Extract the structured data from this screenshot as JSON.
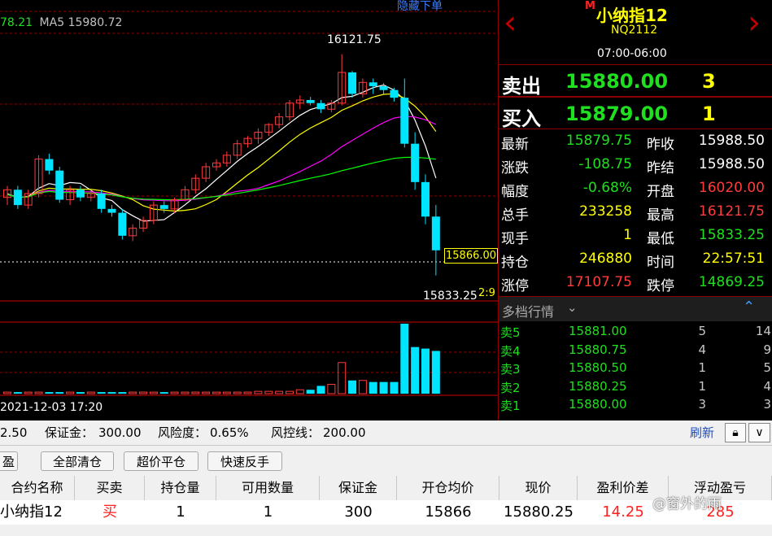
{
  "chart": {
    "hide_order_link": "隐藏下单",
    "ma_partial": "78.21",
    "ma5_label": "MA5",
    "ma5_value": "15980.72",
    "high_label": "16121.75",
    "low_label": "15833.25",
    "current_tag": "15866.00",
    "ratio_tag": "2:9",
    "date_label": "2021-12-03 17:20",
    "colors": {
      "up": "#ff3b3b",
      "down": "#00e5ff",
      "ma5": "#ffffff",
      "ma10": "#ffff00",
      "ma20": "#ff00ff",
      "ma60": "#00ff00",
      "grid": "#8a0000"
    }
  },
  "chart_data": {
    "type": "candlestick",
    "price_range": [
      15800,
      16150
    ],
    "candles": [
      {
        "o": 15935,
        "c": 15945,
        "h": 15950,
        "l": 15925
      },
      {
        "o": 15945,
        "c": 15925,
        "h": 15950,
        "l": 15920
      },
      {
        "o": 15925,
        "c": 15940,
        "h": 15945,
        "l": 15920
      },
      {
        "o": 15940,
        "c": 15985,
        "h": 15990,
        "l": 15935
      },
      {
        "o": 15985,
        "c": 15970,
        "h": 15992,
        "l": 15965
      },
      {
        "o": 15970,
        "c": 15932,
        "h": 15975,
        "l": 15928
      },
      {
        "o": 15932,
        "c": 15945,
        "h": 15950,
        "l": 15925
      },
      {
        "o": 15945,
        "c": 15935,
        "h": 15950,
        "l": 15930
      },
      {
        "o": 15935,
        "c": 15940,
        "h": 15945,
        "l": 15930
      },
      {
        "o": 15940,
        "c": 15920,
        "h": 15945,
        "l": 15915
      },
      {
        "o": 15920,
        "c": 15915,
        "h": 15925,
        "l": 15910
      },
      {
        "o": 15915,
        "c": 15885,
        "h": 15920,
        "l": 15880
      },
      {
        "o": 15885,
        "c": 15895,
        "h": 15900,
        "l": 15878
      },
      {
        "o": 15895,
        "c": 15905,
        "h": 15910,
        "l": 15890
      },
      {
        "o": 15905,
        "c": 15925,
        "h": 15930,
        "l": 15900
      },
      {
        "o": 15925,
        "c": 15920,
        "h": 15930,
        "l": 15915
      },
      {
        "o": 15920,
        "c": 15932,
        "h": 15935,
        "l": 15915
      },
      {
        "o": 15932,
        "c": 15945,
        "h": 15950,
        "l": 15930
      },
      {
        "o": 15945,
        "c": 15960,
        "h": 15965,
        "l": 15940
      },
      {
        "o": 15960,
        "c": 15975,
        "h": 15980,
        "l": 15955
      },
      {
        "o": 15975,
        "c": 15980,
        "h": 15985,
        "l": 15970
      },
      {
        "o": 15980,
        "c": 15990,
        "h": 15995,
        "l": 15975
      },
      {
        "o": 15990,
        "c": 16005,
        "h": 16010,
        "l": 15985
      },
      {
        "o": 16005,
        "c": 16012,
        "h": 16015,
        "l": 16000
      },
      {
        "o": 16012,
        "c": 16020,
        "h": 16025,
        "l": 16005
      },
      {
        "o": 16020,
        "c": 16030,
        "h": 16032,
        "l": 16015
      },
      {
        "o": 16030,
        "c": 16040,
        "h": 16045,
        "l": 16025
      },
      {
        "o": 16040,
        "c": 16058,
        "h": 16062,
        "l": 16035
      },
      {
        "o": 16058,
        "c": 16062,
        "h": 16068,
        "l": 16050
      },
      {
        "o": 16062,
        "c": 16058,
        "h": 16066,
        "l": 16055
      },
      {
        "o": 16058,
        "c": 16050,
        "h": 16062,
        "l": 16045
      },
      {
        "o": 16050,
        "c": 16058,
        "h": 16062,
        "l": 16046
      },
      {
        "o": 16058,
        "c": 16098,
        "h": 16121.75,
        "l": 16055
      },
      {
        "o": 16098,
        "c": 16070,
        "h": 16100,
        "l": 16065
      },
      {
        "o": 16070,
        "c": 16085,
        "h": 16090,
        "l": 16065
      },
      {
        "o": 16085,
        "c": 16080,
        "h": 16090,
        "l": 16070
      },
      {
        "o": 16080,
        "c": 16075,
        "h": 16084,
        "l": 16070
      },
      {
        "o": 16075,
        "c": 16065,
        "h": 16078,
        "l": 16060
      },
      {
        "o": 16065,
        "c": 16005,
        "h": 16090,
        "l": 16000
      },
      {
        "o": 16005,
        "c": 15955,
        "h": 16020,
        "l": 15945
      },
      {
        "o": 15955,
        "c": 15910,
        "h": 15965,
        "l": 15900
      },
      {
        "o": 15910,
        "c": 15866,
        "h": 15925,
        "l": 15833.25
      }
    ],
    "volume": [
      2,
      2,
      2,
      2,
      2,
      2,
      2,
      2,
      2,
      2,
      2,
      2,
      2,
      2,
      2,
      2,
      2,
      2,
      2,
      2,
      2,
      2,
      2,
      2,
      3,
      3,
      3,
      3,
      5,
      5,
      10,
      12,
      40,
      17,
      17,
      15,
      15,
      15,
      90,
      60,
      58,
      55
    ]
  },
  "quote": {
    "exchange_mark": "M",
    "name": "小纳指12",
    "code": "NQ2112",
    "session": "07:00-06:00",
    "sell_label": "卖出",
    "sell_price": "15880.00",
    "sell_qty": "3",
    "buy_label": "买入",
    "buy_price": "15879.00",
    "buy_qty": "1",
    "rows": [
      {
        "l1": "最新",
        "v1": "15879.75",
        "c1": "#1ee01e",
        "l2": "昨收",
        "v2": "15988.50",
        "c2": "#ffffff"
      },
      {
        "l1": "涨跌",
        "v1": "-108.75",
        "c1": "#1ee01e",
        "l2": "昨结",
        "v2": "15988.50",
        "c2": "#ffffff"
      },
      {
        "l1": "幅度",
        "v1": "-0.68%",
        "c1": "#1ee01e",
        "l2": "开盘",
        "v2": "16020.00",
        "c2": "#ff3b3b"
      },
      {
        "l1": "总手",
        "v1": "233258",
        "c1": "#ffff00",
        "l2": "最高",
        "v2": "16121.75",
        "c2": "#ff3b3b"
      },
      {
        "l1": "现手",
        "v1": "1",
        "c1": "#ffff00",
        "l2": "最低",
        "v2": "15833.25",
        "c2": "#1ee01e"
      },
      {
        "l1": "持仓",
        "v1": "246880",
        "c1": "#ffff00",
        "l2": "时间",
        "v2": "22:57:51",
        "c2": "#ffff00"
      },
      {
        "l1": "涨停",
        "v1": "17107.75",
        "c1": "#ff3b3b",
        "l2": "跌停",
        "v2": "14869.25",
        "c2": "#1ee01e"
      }
    ],
    "depth_title": "多档行情",
    "depth": [
      {
        "label": "卖5",
        "price": "15881.00",
        "qty": "5",
        "count": "14"
      },
      {
        "label": "卖4",
        "price": "15880.75",
        "qty": "4",
        "count": "9"
      },
      {
        "label": "卖3",
        "price": "15880.50",
        "qty": "1",
        "count": "5"
      },
      {
        "label": "卖2",
        "price": "15880.25",
        "qty": "1",
        "count": "4"
      },
      {
        "label": "卖1",
        "price": "15880.00",
        "qty": "3",
        "count": "3"
      }
    ]
  },
  "account": {
    "balance_partial": "2.50",
    "margin_label": "保证金：",
    "margin_value": "300.00",
    "risk_label": "风险度：",
    "risk_value": "0.65%",
    "control_label": "风控线：",
    "control_value": "200.00",
    "refresh": "刷新"
  },
  "toolbar": {
    "tab_partial": "盈",
    "close_all": "全部清仓",
    "super_close": "超价平仓",
    "quick_reverse": "快速反手"
  },
  "positions": {
    "headers": [
      "合约名称",
      "买卖",
      "持仓量",
      "可用数量",
      "保证金",
      "开仓均价",
      "现价",
      "盈利价差",
      "浮动盈亏"
    ],
    "row": [
      "小纳指12",
      "买",
      "1",
      "1",
      "300",
      "15866",
      "15880.25",
      "14.25",
      "285"
    ]
  },
  "watermark": "@窗外的雨"
}
